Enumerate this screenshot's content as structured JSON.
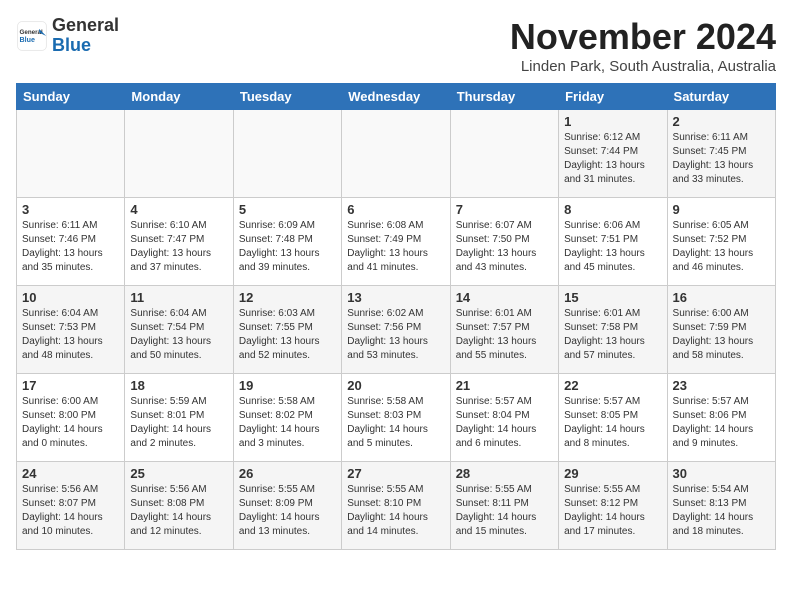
{
  "header": {
    "logo_general": "General",
    "logo_blue": "Blue",
    "month_title": "November 2024",
    "location": "Linden Park, South Australia, Australia"
  },
  "days_of_week": [
    "Sunday",
    "Monday",
    "Tuesday",
    "Wednesday",
    "Thursday",
    "Friday",
    "Saturday"
  ],
  "weeks": [
    [
      {
        "day": "",
        "info": ""
      },
      {
        "day": "",
        "info": ""
      },
      {
        "day": "",
        "info": ""
      },
      {
        "day": "",
        "info": ""
      },
      {
        "day": "",
        "info": ""
      },
      {
        "day": "1",
        "info": "Sunrise: 6:12 AM\nSunset: 7:44 PM\nDaylight: 13 hours\nand 31 minutes."
      },
      {
        "day": "2",
        "info": "Sunrise: 6:11 AM\nSunset: 7:45 PM\nDaylight: 13 hours\nand 33 minutes."
      }
    ],
    [
      {
        "day": "3",
        "info": "Sunrise: 6:11 AM\nSunset: 7:46 PM\nDaylight: 13 hours\nand 35 minutes."
      },
      {
        "day": "4",
        "info": "Sunrise: 6:10 AM\nSunset: 7:47 PM\nDaylight: 13 hours\nand 37 minutes."
      },
      {
        "day": "5",
        "info": "Sunrise: 6:09 AM\nSunset: 7:48 PM\nDaylight: 13 hours\nand 39 minutes."
      },
      {
        "day": "6",
        "info": "Sunrise: 6:08 AM\nSunset: 7:49 PM\nDaylight: 13 hours\nand 41 minutes."
      },
      {
        "day": "7",
        "info": "Sunrise: 6:07 AM\nSunset: 7:50 PM\nDaylight: 13 hours\nand 43 minutes."
      },
      {
        "day": "8",
        "info": "Sunrise: 6:06 AM\nSunset: 7:51 PM\nDaylight: 13 hours\nand 45 minutes."
      },
      {
        "day": "9",
        "info": "Sunrise: 6:05 AM\nSunset: 7:52 PM\nDaylight: 13 hours\nand 46 minutes."
      }
    ],
    [
      {
        "day": "10",
        "info": "Sunrise: 6:04 AM\nSunset: 7:53 PM\nDaylight: 13 hours\nand 48 minutes."
      },
      {
        "day": "11",
        "info": "Sunrise: 6:04 AM\nSunset: 7:54 PM\nDaylight: 13 hours\nand 50 minutes."
      },
      {
        "day": "12",
        "info": "Sunrise: 6:03 AM\nSunset: 7:55 PM\nDaylight: 13 hours\nand 52 minutes."
      },
      {
        "day": "13",
        "info": "Sunrise: 6:02 AM\nSunset: 7:56 PM\nDaylight: 13 hours\nand 53 minutes."
      },
      {
        "day": "14",
        "info": "Sunrise: 6:01 AM\nSunset: 7:57 PM\nDaylight: 13 hours\nand 55 minutes."
      },
      {
        "day": "15",
        "info": "Sunrise: 6:01 AM\nSunset: 7:58 PM\nDaylight: 13 hours\nand 57 minutes."
      },
      {
        "day": "16",
        "info": "Sunrise: 6:00 AM\nSunset: 7:59 PM\nDaylight: 13 hours\nand 58 minutes."
      }
    ],
    [
      {
        "day": "17",
        "info": "Sunrise: 6:00 AM\nSunset: 8:00 PM\nDaylight: 14 hours\nand 0 minutes."
      },
      {
        "day": "18",
        "info": "Sunrise: 5:59 AM\nSunset: 8:01 PM\nDaylight: 14 hours\nand 2 minutes."
      },
      {
        "day": "19",
        "info": "Sunrise: 5:58 AM\nSunset: 8:02 PM\nDaylight: 14 hours\nand 3 minutes."
      },
      {
        "day": "20",
        "info": "Sunrise: 5:58 AM\nSunset: 8:03 PM\nDaylight: 14 hours\nand 5 minutes."
      },
      {
        "day": "21",
        "info": "Sunrise: 5:57 AM\nSunset: 8:04 PM\nDaylight: 14 hours\nand 6 minutes."
      },
      {
        "day": "22",
        "info": "Sunrise: 5:57 AM\nSunset: 8:05 PM\nDaylight: 14 hours\nand 8 minutes."
      },
      {
        "day": "23",
        "info": "Sunrise: 5:57 AM\nSunset: 8:06 PM\nDaylight: 14 hours\nand 9 minutes."
      }
    ],
    [
      {
        "day": "24",
        "info": "Sunrise: 5:56 AM\nSunset: 8:07 PM\nDaylight: 14 hours\nand 10 minutes."
      },
      {
        "day": "25",
        "info": "Sunrise: 5:56 AM\nSunset: 8:08 PM\nDaylight: 14 hours\nand 12 minutes."
      },
      {
        "day": "26",
        "info": "Sunrise: 5:55 AM\nSunset: 8:09 PM\nDaylight: 14 hours\nand 13 minutes."
      },
      {
        "day": "27",
        "info": "Sunrise: 5:55 AM\nSunset: 8:10 PM\nDaylight: 14 hours\nand 14 minutes."
      },
      {
        "day": "28",
        "info": "Sunrise: 5:55 AM\nSunset: 8:11 PM\nDaylight: 14 hours\nand 15 minutes."
      },
      {
        "day": "29",
        "info": "Sunrise: 5:55 AM\nSunset: 8:12 PM\nDaylight: 14 hours\nand 17 minutes."
      },
      {
        "day": "30",
        "info": "Sunrise: 5:54 AM\nSunset: 8:13 PM\nDaylight: 14 hours\nand 18 minutes."
      }
    ]
  ]
}
